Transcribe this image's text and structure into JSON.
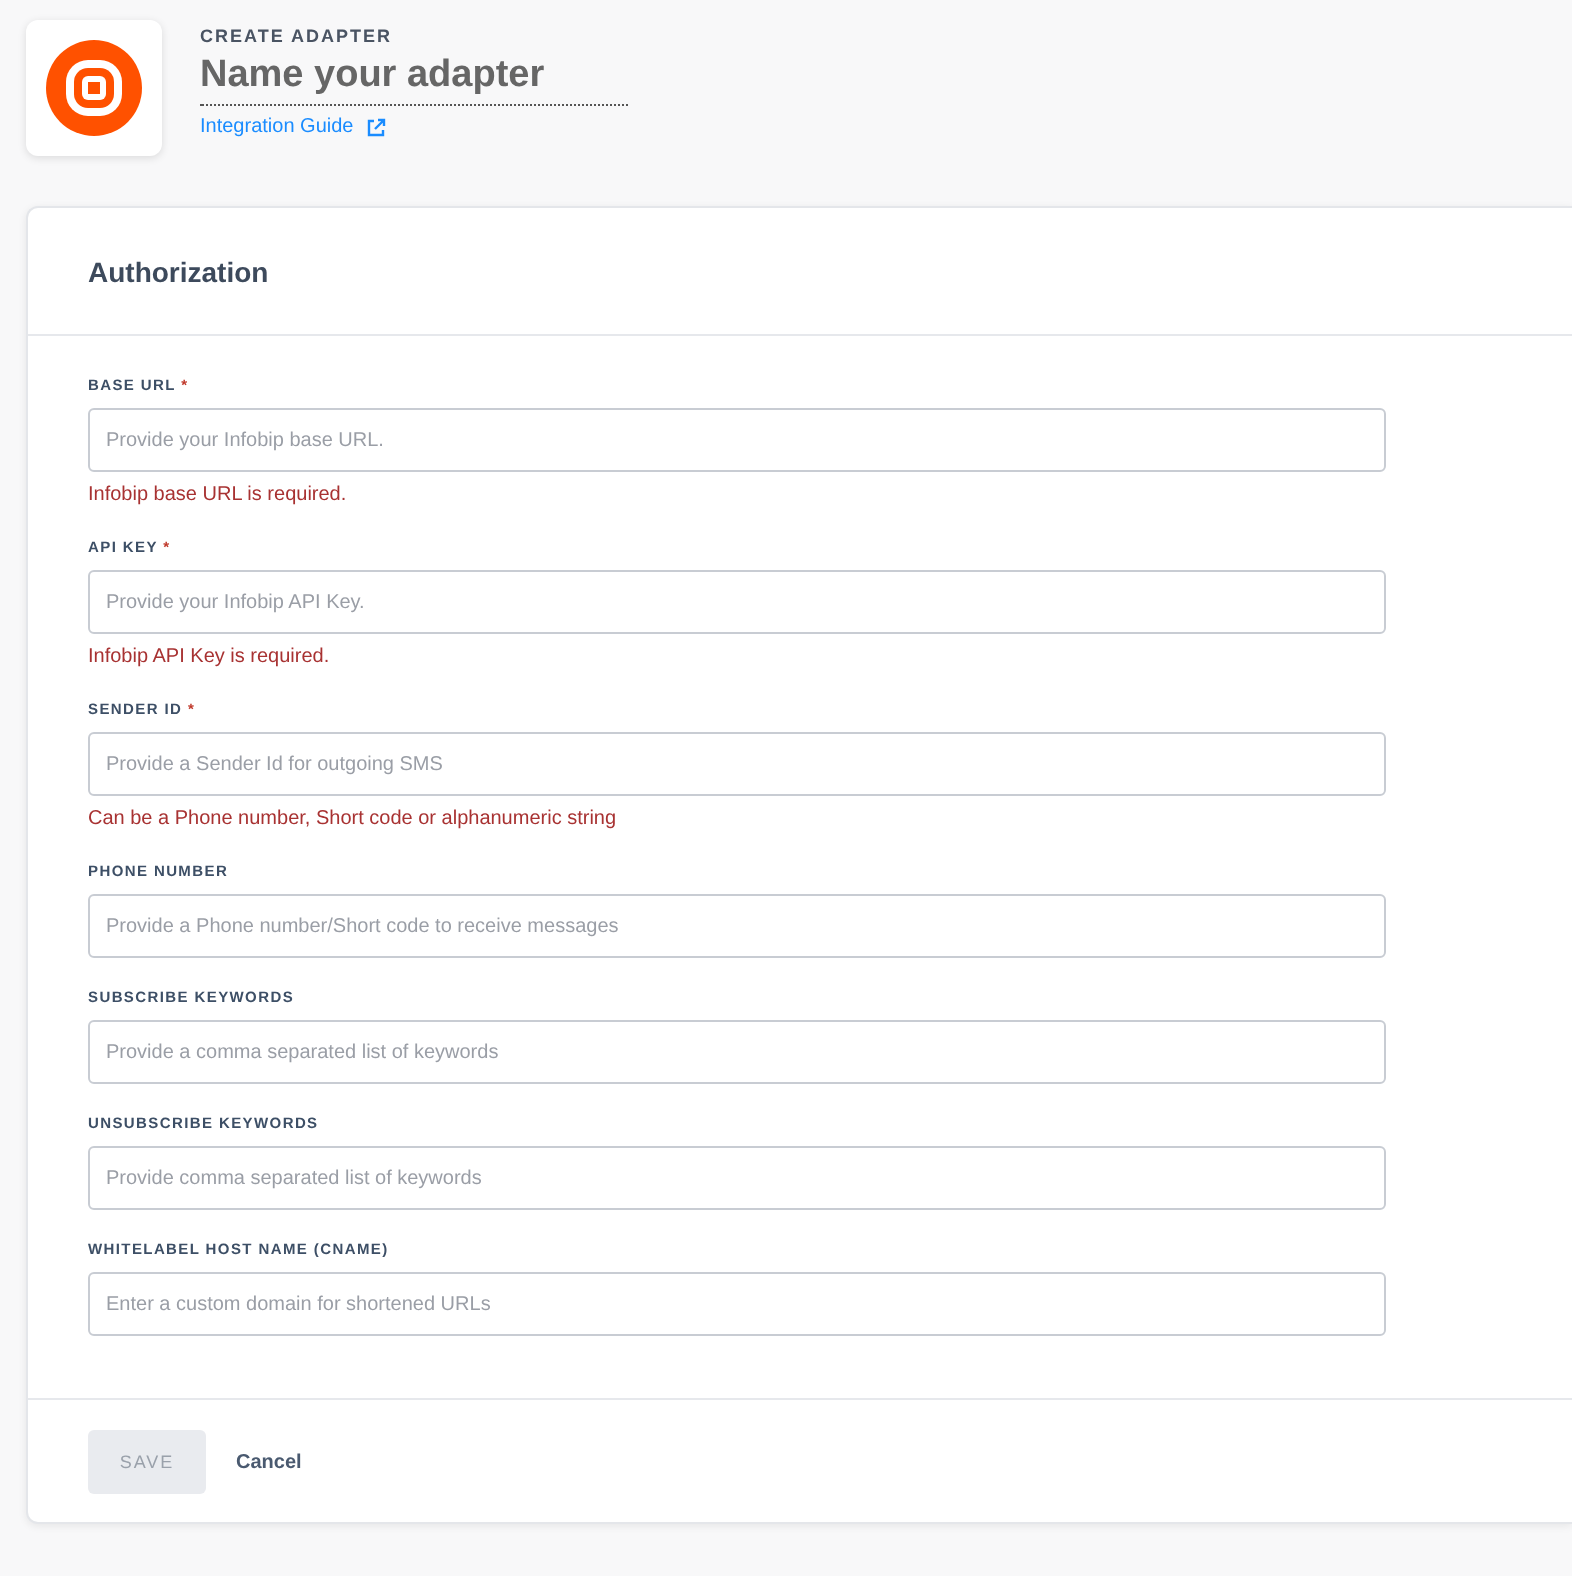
{
  "header": {
    "eyebrow": "CREATE ADAPTER",
    "name_field": {
      "placeholder": "Name your adapter"
    },
    "guide_link": "Integration Guide"
  },
  "section": {
    "title": "Authorization"
  },
  "fields": [
    {
      "label": "BASE URL",
      "required_mark": "*",
      "placeholder": "Provide your Infobip base URL.",
      "message": "Infobip base URL is required."
    },
    {
      "label": "API KEY",
      "required_mark": "*",
      "placeholder": "Provide your Infobip API Key.",
      "message": "Infobip API Key is required."
    },
    {
      "label": "SENDER ID",
      "required_mark": "*",
      "placeholder": "Provide a Sender Id for outgoing SMS",
      "message": "Can be a Phone number, Short code or alphanumeric string"
    },
    {
      "label": "PHONE NUMBER",
      "placeholder": "Provide a Phone number/Short code to receive messages"
    },
    {
      "label": "SUBSCRIBE KEYWORDS",
      "placeholder": "Provide a comma separated list of keywords"
    },
    {
      "label": "UNSUBSCRIBE KEYWORDS",
      "placeholder": "Provide comma separated list of keywords"
    },
    {
      "label": "WHITELABEL HOST NAME (CNAME)",
      "placeholder": "Enter a custom domain for shortened URLs"
    }
  ],
  "actions": {
    "save": {
      "label": "SAVE",
      "disabled": true
    },
    "cancel": "Cancel"
  }
}
